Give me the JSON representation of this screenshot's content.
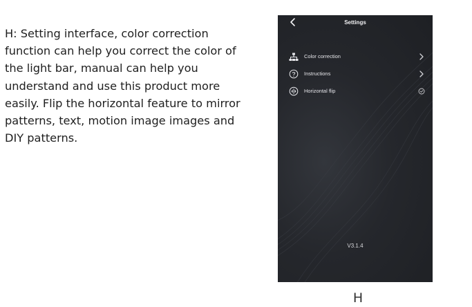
{
  "description": "H: Setting interface, color correction function can help you correct the color of the light bar, manual can help you understand and use this product more easily. Flip the horizontal feature to mirror patterns, text, motion image images and DIY patterns.",
  "screen": {
    "title": "Settings",
    "back_icon": "chevron-left-icon",
    "items": [
      {
        "label": "Color correction",
        "icon": "color-correction-icon",
        "trailing": "chevron-right-icon"
      },
      {
        "label": "Instructions",
        "icon": "question-circle-icon",
        "trailing": "chevron-right-icon"
      },
      {
        "label": "Horizontal flip",
        "icon": "flip-icon",
        "trailing": "check-circle-icon"
      }
    ],
    "version": "V3.1.4",
    "colors": {
      "background": "#25272c",
      "text": "#e6e6ea"
    }
  },
  "caption": "H"
}
